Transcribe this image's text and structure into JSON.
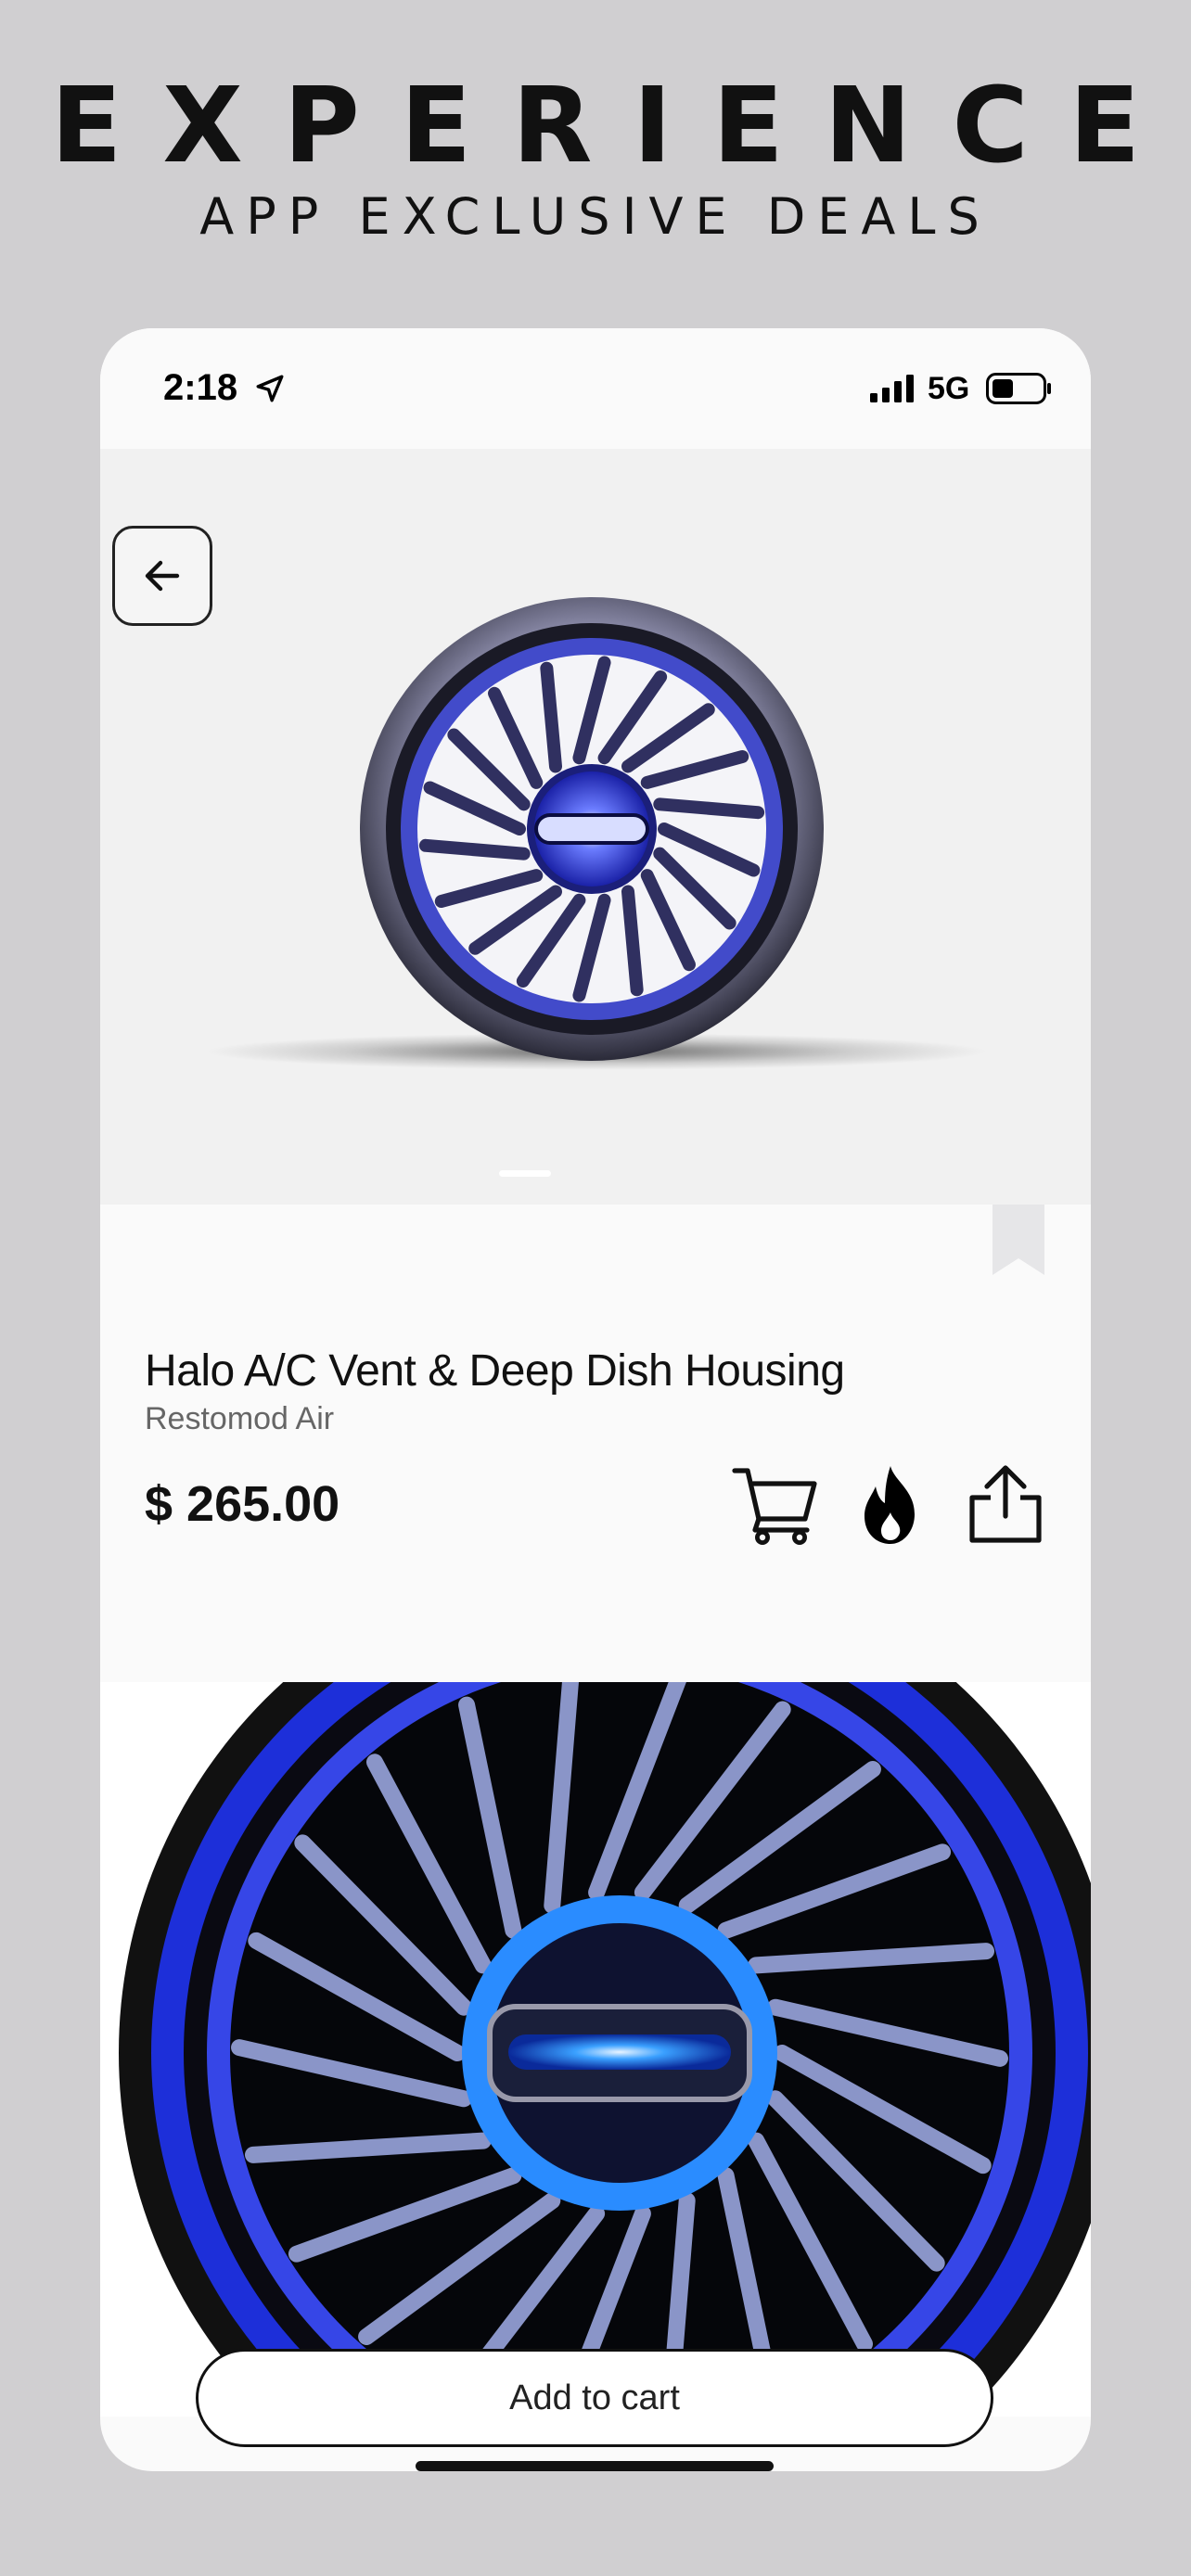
{
  "promo": {
    "headline": "EXPERIENCE",
    "subheadline": "APP EXCLUSIVE DEALS"
  },
  "status_bar": {
    "time": "2:18",
    "network": "5G",
    "icons": [
      "location-arrow-icon",
      "signal-icon",
      "battery-icon"
    ]
  },
  "product": {
    "title": "Halo A/C Vent & Deep Dish Housing",
    "vendor": "Restomod Air",
    "price": "$ 265.00",
    "gallery_page": 1
  },
  "actions": {
    "back_icon": "arrow-left-icon",
    "bookmark_icon": "bookmark-icon",
    "cart_icon": "cart-icon",
    "hot_icon": "fire-icon",
    "share_icon": "share-icon",
    "add_to_cart_label": "Add to cart"
  },
  "colors": {
    "accent_blue": "#3a52ff",
    "page_background": "#d0cfd1",
    "screen_background": "#fafafa"
  }
}
